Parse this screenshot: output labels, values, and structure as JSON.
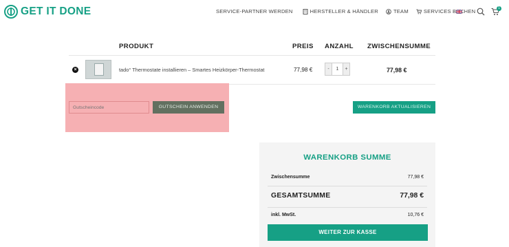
{
  "brand": {
    "name": "GET IT DONE",
    "color": "#16a085"
  },
  "nav": {
    "items": [
      {
        "label": "SERVICE-PARTNER WERDEN",
        "icon": ""
      },
      {
        "label": "HERSTELLER & HÄNDLER",
        "icon": "building-icon"
      },
      {
        "label": "TEAM",
        "icon": "user-icon"
      },
      {
        "label": "SERVICES BUCHEN",
        "icon": "cart-icon"
      }
    ],
    "language_flag": "uk-flag-icon",
    "cart_count": "1"
  },
  "table": {
    "headers": {
      "product": "PRODUKT",
      "price": "PREIS",
      "quantity": "ANZAHL",
      "subtotal": "ZWISCHENSUMME"
    },
    "rows": [
      {
        "name": "tado° Thermostate installieren – Smartes Heizkörper-Thermostat",
        "price": "77,98 €",
        "quantity": "1",
        "subtotal": "77,98 €"
      }
    ]
  },
  "coupon": {
    "placeholder": "Gutscheincode",
    "apply_label": "GUTSCHEIN ANWENDEN"
  },
  "update_cart_label": "WARENKORB AKTUALISIEREN",
  "totals": {
    "title": "WARENKORB SUMME",
    "subtotal_label": "Zwischensumme",
    "subtotal_value": "77,98 €",
    "total_label": "GESAMTSUMME",
    "total_value": "77,98 €",
    "vat_label": "inkl. MwSt.",
    "vat_value": "10,76 €",
    "checkout_label": "WEITER ZUR KASSE"
  }
}
